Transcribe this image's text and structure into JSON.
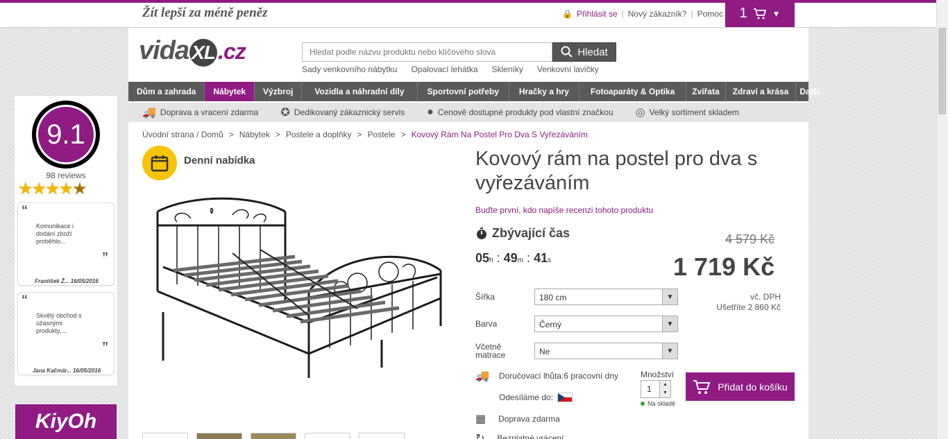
{
  "header": {
    "slogan": "Žít lepší za méně peněz",
    "login": "Přihlásit se",
    "new_customer": "Nový zákazník?",
    "help": "Pomoc",
    "cart_count": "1"
  },
  "logo": {
    "pre": "vida",
    "mid": "XL",
    "post": ".cz"
  },
  "search": {
    "placeholder": "Hledat podle názvu produktu nebo klíčového slova",
    "button": "Hledat",
    "suggestions": [
      "Sady venkovního nábytku",
      "Opalovací lehátka",
      "Skleníky",
      "Venkovní lavičky"
    ]
  },
  "nav": [
    "Dům a zahrada",
    "Nábytek",
    "Výzbroj",
    "Vozidla a náhradní díly",
    "Sportovní potřeby",
    "Hračky a hry",
    "Fotoaparáty & Optika",
    "Zvířata",
    "Zdraví a krása",
    "Další"
  ],
  "usp": [
    "Doprava a vracení zdarma",
    "Dedikovaný zákaznický servis",
    "Cenově dostupné produkty pod vlastní značkou",
    "Velký sortiment skladem"
  ],
  "breadcrumb": [
    "Úvodní strana / Domů",
    "Nábytek",
    "Postele a doplňky",
    "Postele",
    "Kovový Rám Na Postel Pro Dva S Vyřezáváním"
  ],
  "breadcrumb_sep": ">",
  "daily": "Denní nabídka",
  "product": {
    "title": "Kovový rám na postel pro dva s vyřezáváním",
    "review_link": "Buďte první, kdo napíše recenzi tohoto produktu",
    "timer_label": "Zbývající čas",
    "timer": {
      "h": "05",
      "h_unit": "h",
      "m": "49",
      "m_unit": "m",
      "s": "41",
      "s_unit": "s",
      "sep": ":"
    },
    "old_price": "4 579 Kč",
    "price": "1 719 Kč",
    "vat": "vč. DPH",
    "save": "Ušetříte 2 860 Kč",
    "options": [
      {
        "label": "Šířka",
        "value": "180 cm"
      },
      {
        "label": "Barva",
        "value": "Černý"
      },
      {
        "label": "Včetně matrace",
        "value": "Ne"
      }
    ],
    "delivery": "Doručovací lhůta:6 pracovní dny",
    "ship_from": "Odesíláme do:",
    "free_shipping": "Doprava zdarma",
    "free_return": "Bezplatné vrácení",
    "qty_label": "Množství",
    "qty": "1",
    "stock": "Na skladě",
    "add_to_cart": "Přidat do košíku"
  },
  "widget": {
    "score": "9.1",
    "reviews": "98 reviews",
    "rating": 4.5,
    "cards": [
      {
        "text": "Komunikace i dodání zboží proběhlo...",
        "author": "František Ž... 16/05/2016"
      },
      {
        "text": "Skvělý obchod s úžasnými produkty,...",
        "author": "Jana Kačmár... 16/05/2016"
      }
    ],
    "brand": "KiyOh"
  },
  "colors": {
    "accent": "#8f1b83",
    "nav": "#5a5a5a",
    "badge": "#f6c400"
  }
}
